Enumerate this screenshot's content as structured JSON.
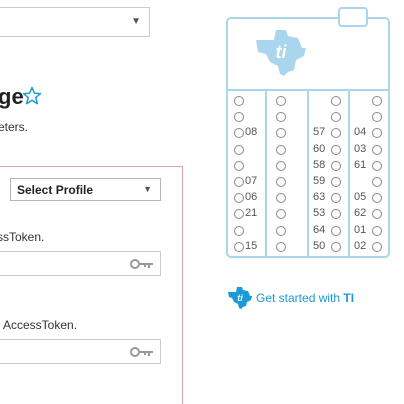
{
  "top_dropdown": {
    "value": ""
  },
  "heading": {
    "title": "ge",
    "subtitle": "eters."
  },
  "profile": {
    "select_label": "Select Profile"
  },
  "fields": [
    {
      "label": "ssToken."
    },
    {
      "label": "AccessToken."
    }
  ],
  "get_started": {
    "text": "Get started with ",
    "brand": "TI"
  },
  "colors": {
    "accent": "#1a9ad8",
    "card_border": "#a9d6ec",
    "panel_border": "#e3a7a7"
  },
  "pin_rows": [
    [
      "",
      "",
      "",
      ""
    ],
    [
      "",
      "",
      "",
      ""
    ],
    [
      "08",
      "",
      "57",
      "04"
    ],
    [
      "",
      "",
      "60",
      "03"
    ],
    [
      "",
      "",
      "58",
      "61"
    ],
    [
      "07",
      "",
      "59",
      ""
    ],
    [
      "06",
      "",
      "63",
      "05"
    ],
    [
      "21",
      "",
      "53",
      "62"
    ],
    [
      "",
      "",
      "64",
      "01"
    ],
    [
      "15",
      "",
      "50",
      "02"
    ]
  ]
}
